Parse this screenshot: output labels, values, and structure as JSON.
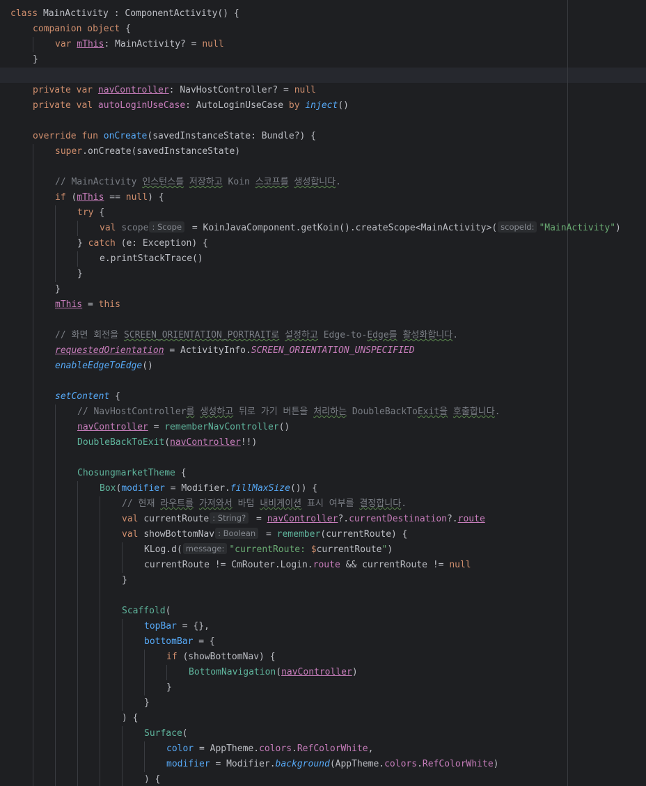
{
  "editor": {
    "lines": [
      {
        "indent": 0,
        "tokens": [
          {
            "t": "class ",
            "c": "kw"
          },
          {
            "t": "MainActivity : ComponentActivity() {",
            "c": "txt"
          }
        ]
      },
      {
        "indent": 1,
        "tokens": [
          {
            "t": "companion object ",
            "c": "kw"
          },
          {
            "t": "{",
            "c": "txt"
          }
        ]
      },
      {
        "indent": 2,
        "tokens": [
          {
            "t": "var ",
            "c": "kw"
          },
          {
            "t": "mThis",
            "c": "prop und"
          },
          {
            "t": ": MainActivity? = ",
            "c": "txt"
          },
          {
            "t": "null",
            "c": "kw"
          }
        ]
      },
      {
        "indent": 1,
        "tokens": [
          {
            "t": "}",
            "c": "txt"
          }
        ]
      },
      {
        "indent": 0,
        "tokens": []
      },
      {
        "indent": 1,
        "tokens": [
          {
            "t": "private var ",
            "c": "kw"
          },
          {
            "t": "navController",
            "c": "prop und"
          },
          {
            "t": ": NavHostController? = ",
            "c": "txt"
          },
          {
            "t": "null",
            "c": "kw"
          }
        ]
      },
      {
        "indent": 1,
        "tokens": [
          {
            "t": "private val ",
            "c": "kw"
          },
          {
            "t": "autoLoginUseCase",
            "c": "prop"
          },
          {
            "t": ": AutoLoginUseCase ",
            "c": "txt"
          },
          {
            "t": "by ",
            "c": "kw"
          },
          {
            "t": "inject",
            "c": "fni"
          },
          {
            "t": "()",
            "c": "txt"
          }
        ]
      },
      {
        "indent": 0,
        "tokens": []
      },
      {
        "indent": 1,
        "tokens": [
          {
            "t": "override fun ",
            "c": "kw"
          },
          {
            "t": "onCreate",
            "c": "fn"
          },
          {
            "t": "(savedInstanceState: Bundle?) {",
            "c": "txt"
          }
        ]
      },
      {
        "indent": 2,
        "tokens": [
          {
            "t": "super",
            "c": "kw"
          },
          {
            "t": ".onCreate(savedInstanceState)",
            "c": "txt"
          }
        ]
      },
      {
        "indent": 0,
        "tokens": []
      },
      {
        "indent": 2,
        "tokens": [
          {
            "t": "// MainActivity ",
            "c": "cmt"
          },
          {
            "t": "인스턴스를",
            "c": "cmt typo"
          },
          {
            "t": " ",
            "c": "cmt"
          },
          {
            "t": "저장하고",
            "c": "cmt typo"
          },
          {
            "t": " Koin ",
            "c": "cmt"
          },
          {
            "t": "스코프를",
            "c": "cmt typo"
          },
          {
            "t": " ",
            "c": "cmt"
          },
          {
            "t": "생성합니다",
            "c": "cmt typo"
          },
          {
            "t": ".",
            "c": "cmt"
          }
        ]
      },
      {
        "indent": 2,
        "tokens": [
          {
            "t": "if ",
            "c": "kw"
          },
          {
            "t": "(",
            "c": "txt"
          },
          {
            "t": "mThis",
            "c": "prop und"
          },
          {
            "t": " == ",
            "c": "txt"
          },
          {
            "t": "null",
            "c": "kw"
          },
          {
            "t": ") {",
            "c": "txt"
          }
        ]
      },
      {
        "indent": 3,
        "tokens": [
          {
            "t": "try ",
            "c": "kw"
          },
          {
            "t": "{",
            "c": "txt"
          }
        ]
      },
      {
        "indent": 4,
        "tokens": [
          {
            "t": "val ",
            "c": "kw"
          },
          {
            "t": "scope",
            "c": "cmt"
          },
          {
            "h": ": Scope"
          },
          {
            "t": " = KoinJavaComponent.getKoin().createScope<MainActivity>(",
            "c": "txt"
          },
          {
            "h": "scopeId:"
          },
          {
            "t": "\"MainActivity\"",
            "c": "str"
          },
          {
            "t": ")",
            "c": "txt"
          }
        ]
      },
      {
        "indent": 3,
        "tokens": [
          {
            "t": "} ",
            "c": "txt"
          },
          {
            "t": "catch ",
            "c": "kw"
          },
          {
            "t": "(e: Exception) {",
            "c": "txt"
          }
        ]
      },
      {
        "indent": 4,
        "tokens": [
          {
            "t": "e.printStackTrace()",
            "c": "txt"
          }
        ]
      },
      {
        "indent": 3,
        "tokens": [
          {
            "t": "}",
            "c": "txt"
          }
        ]
      },
      {
        "indent": 2,
        "tokens": [
          {
            "t": "}",
            "c": "txt"
          }
        ]
      },
      {
        "indent": 2,
        "tokens": [
          {
            "t": "mThis",
            "c": "prop und"
          },
          {
            "t": " = ",
            "c": "txt"
          },
          {
            "t": "this",
            "c": "kw"
          }
        ]
      },
      {
        "indent": 0,
        "tokens": []
      },
      {
        "indent": 2,
        "tokens": [
          {
            "t": "// 화면 회전을 ",
            "c": "cmt"
          },
          {
            "t": "SCREEN_ORIENTATION_PORTRAIT로",
            "c": "cmt typo"
          },
          {
            "t": " ",
            "c": "cmt"
          },
          {
            "t": "설정하고",
            "c": "cmt typo"
          },
          {
            "t": " Edge-to-",
            "c": "cmt"
          },
          {
            "t": "Edge를",
            "c": "cmt typo"
          },
          {
            "t": " ",
            "c": "cmt"
          },
          {
            "t": "활성화합니다",
            "c": "cmt typo"
          },
          {
            "t": ".",
            "c": "cmt"
          }
        ]
      },
      {
        "indent": 2,
        "tokens": [
          {
            "t": "requestedOrientation",
            "c": "cst und"
          },
          {
            "t": " = ActivityInfo.",
            "c": "txt"
          },
          {
            "t": "SCREEN_ORIENTATION_UNSPECIFIED",
            "c": "cst"
          }
        ]
      },
      {
        "indent": 2,
        "tokens": [
          {
            "t": "enableEdgeToEdge",
            "c": "fni"
          },
          {
            "t": "()",
            "c": "txt"
          }
        ]
      },
      {
        "indent": 0,
        "tokens": []
      },
      {
        "indent": 2,
        "tokens": [
          {
            "t": "setContent",
            "c": "fni"
          },
          {
            "t": " {",
            "c": "txt"
          }
        ]
      },
      {
        "indent": 3,
        "tokens": [
          {
            "t": "// NavHostController",
            "c": "cmt"
          },
          {
            "t": "를",
            "c": "cmt typo"
          },
          {
            "t": " ",
            "c": "cmt"
          },
          {
            "t": "생성하고",
            "c": "cmt typo"
          },
          {
            "t": " 뒤로 가기 버튼을 ",
            "c": "cmt"
          },
          {
            "t": "처리하는",
            "c": "cmt typo"
          },
          {
            "t": " DoubleBackTo",
            "c": "cmt"
          },
          {
            "t": "Exit을",
            "c": "cmt typo"
          },
          {
            "t": " ",
            "c": "cmt"
          },
          {
            "t": "호출합니다",
            "c": "cmt typo"
          },
          {
            "t": ".",
            "c": "cmt"
          }
        ]
      },
      {
        "indent": 3,
        "tokens": [
          {
            "t": "navController",
            "c": "prop und"
          },
          {
            "t": " = ",
            "c": "txt"
          },
          {
            "t": "rememberNavController",
            "c": "cmp"
          },
          {
            "t": "()",
            "c": "txt"
          }
        ]
      },
      {
        "indent": 3,
        "tokens": [
          {
            "t": "DoubleBackToExit",
            "c": "cmp"
          },
          {
            "t": "(",
            "c": "txt"
          },
          {
            "t": "navController",
            "c": "prop und"
          },
          {
            "t": "!!)",
            "c": "txt"
          }
        ]
      },
      {
        "indent": 0,
        "tokens": []
      },
      {
        "indent": 3,
        "tokens": [
          {
            "t": "ChosungmarketTheme",
            "c": "cmp"
          },
          {
            "t": " {",
            "c": "txt"
          }
        ]
      },
      {
        "indent": 4,
        "tokens": [
          {
            "t": "Box",
            "c": "cmp"
          },
          {
            "t": "(",
            "c": "txt"
          },
          {
            "t": "modifier",
            "c": "fn"
          },
          {
            "t": " = Modifier.",
            "c": "txt"
          },
          {
            "t": "fillMaxSize",
            "c": "fni"
          },
          {
            "t": "()) {",
            "c": "txt"
          }
        ]
      },
      {
        "indent": 5,
        "tokens": [
          {
            "t": "// 현재 ",
            "c": "cmt"
          },
          {
            "t": "라우트를",
            "c": "cmt typo"
          },
          {
            "t": " ",
            "c": "cmt"
          },
          {
            "t": "가져와서",
            "c": "cmt typo"
          },
          {
            "t": " 바텀 ",
            "c": "cmt"
          },
          {
            "t": "내비게이션",
            "c": "cmt typo"
          },
          {
            "t": " 표시 여부를 ",
            "c": "cmt"
          },
          {
            "t": "결정합니다",
            "c": "cmt typo"
          },
          {
            "t": ".",
            "c": "cmt"
          }
        ]
      },
      {
        "indent": 5,
        "tokens": [
          {
            "t": "val ",
            "c": "kw"
          },
          {
            "t": "currentRoute",
            "c": "txt"
          },
          {
            "h": ": String?"
          },
          {
            "t": " = ",
            "c": "txt"
          },
          {
            "t": "navController",
            "c": "prop und"
          },
          {
            "t": "?.",
            "c": "txt"
          },
          {
            "t": "currentDestination",
            "c": "prop"
          },
          {
            "t": "?.",
            "c": "txt"
          },
          {
            "t": "route",
            "c": "prop und"
          }
        ]
      },
      {
        "indent": 5,
        "tokens": [
          {
            "t": "val ",
            "c": "kw"
          },
          {
            "t": "showBottomNav",
            "c": "txt"
          },
          {
            "h": ": Boolean"
          },
          {
            "t": " = ",
            "c": "txt"
          },
          {
            "t": "remember",
            "c": "cmp"
          },
          {
            "t": "(currentRoute) {",
            "c": "txt"
          }
        ]
      },
      {
        "indent": 6,
        "tokens": [
          {
            "t": "KLog.d(",
            "c": "txt"
          },
          {
            "h": "message:"
          },
          {
            "t": "\"currentRoute: ",
            "c": "str"
          },
          {
            "t": "$",
            "c": "kw"
          },
          {
            "t": "currentRoute",
            "c": "txt"
          },
          {
            "t": "\"",
            "c": "str"
          },
          {
            "t": ")",
            "c": "txt"
          }
        ]
      },
      {
        "indent": 6,
        "tokens": [
          {
            "t": "currentRoute != CmRouter.Login.",
            "c": "txt"
          },
          {
            "t": "route",
            "c": "prop"
          },
          {
            "t": " && currentRoute != ",
            "c": "txt"
          },
          {
            "t": "null",
            "c": "kw"
          }
        ]
      },
      {
        "indent": 5,
        "tokens": [
          {
            "t": "}",
            "c": "txt"
          }
        ]
      },
      {
        "indent": 0,
        "tokens": []
      },
      {
        "indent": 5,
        "tokens": [
          {
            "t": "Scaffold",
            "c": "cmp"
          },
          {
            "t": "(",
            "c": "txt"
          }
        ]
      },
      {
        "indent": 6,
        "tokens": [
          {
            "t": "topBar",
            "c": "fn"
          },
          {
            "t": " = {},",
            "c": "txt"
          }
        ]
      },
      {
        "indent": 6,
        "tokens": [
          {
            "t": "bottomBar",
            "c": "fn"
          },
          {
            "t": " = {",
            "c": "txt"
          }
        ]
      },
      {
        "indent": 7,
        "tokens": [
          {
            "t": "if ",
            "c": "kw"
          },
          {
            "t": "(showBottomNav) {",
            "c": "txt"
          }
        ]
      },
      {
        "indent": 8,
        "tokens": [
          {
            "t": "BottomNavigation",
            "c": "cmp"
          },
          {
            "t": "(",
            "c": "txt"
          },
          {
            "t": "navController",
            "c": "prop und"
          },
          {
            "t": ")",
            "c": "txt"
          }
        ]
      },
      {
        "indent": 7,
        "tokens": [
          {
            "t": "}",
            "c": "txt"
          }
        ]
      },
      {
        "indent": 6,
        "tokens": [
          {
            "t": "}",
            "c": "txt"
          }
        ]
      },
      {
        "indent": 5,
        "tokens": [
          {
            "t": ") {",
            "c": "txt"
          }
        ]
      },
      {
        "indent": 6,
        "tokens": [
          {
            "t": "Surface",
            "c": "cmp"
          },
          {
            "t": "(",
            "c": "txt"
          }
        ]
      },
      {
        "indent": 7,
        "tokens": [
          {
            "t": "color",
            "c": "fn"
          },
          {
            "t": " = AppTheme.",
            "c": "txt"
          },
          {
            "t": "colors",
            "c": "prop"
          },
          {
            "t": ".",
            "c": "txt"
          },
          {
            "t": "RefColorWhite",
            "c": "prop"
          },
          {
            "t": ",",
            "c": "txt"
          }
        ]
      },
      {
        "indent": 7,
        "tokens": [
          {
            "t": "modifier",
            "c": "fn"
          },
          {
            "t": " = Modifier.",
            "c": "txt"
          },
          {
            "t": "background",
            "c": "fni"
          },
          {
            "t": "(AppTheme.",
            "c": "txt"
          },
          {
            "t": "colors",
            "c": "prop"
          },
          {
            "t": ".",
            "c": "txt"
          },
          {
            "t": "RefColorWhite",
            "c": "prop"
          },
          {
            "t": ")",
            "c": "txt"
          }
        ]
      },
      {
        "indent": 6,
        "tokens": [
          {
            "t": ") {",
            "c": "txt"
          }
        ]
      }
    ]
  },
  "colors": {
    "background": "#1e1f22",
    "caret_row": "#26282e",
    "keyword": "#cf8e6d",
    "function": "#56a8f5",
    "property": "#c77dbb",
    "string": "#6aab73",
    "comment": "#7a7e85",
    "composable": "#5fb49c",
    "text": "#bcbec4"
  }
}
